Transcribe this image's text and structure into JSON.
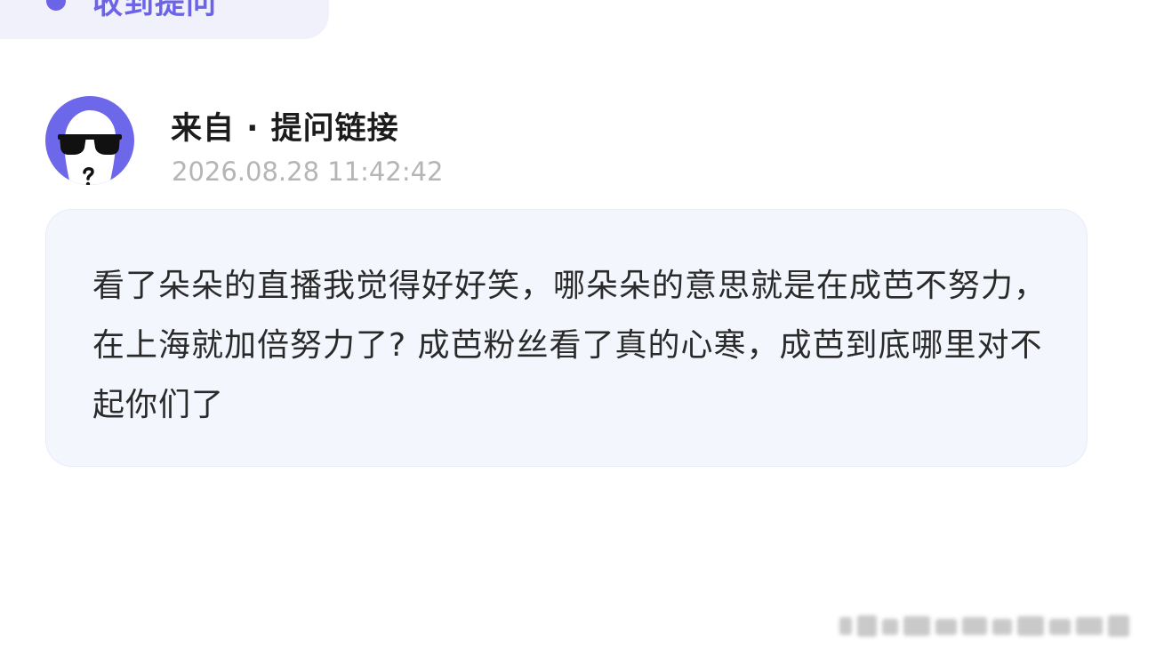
{
  "header": {
    "tab_label": "收到提问"
  },
  "question": {
    "sender": "来自 · 提问链接",
    "timestamp": "2026.08.28 11:42:42",
    "body": "看了朵朵的直播我觉得好好笑，哪朵朵的意思就是在成芭不努力，在上海就加倍努力了? 成芭粉丝看了真的心寒，成芭到底哪里对不起你们了"
  },
  "colors": {
    "accent": "#6b63e8",
    "avatar_bg": "#6d67e9",
    "bubble_bg": "#f3f7fd",
    "timestamp": "#b5b5b5"
  },
  "icons": {
    "tab_dot": "dot-icon",
    "avatar": "anonymous-sunglasses-avatar"
  }
}
